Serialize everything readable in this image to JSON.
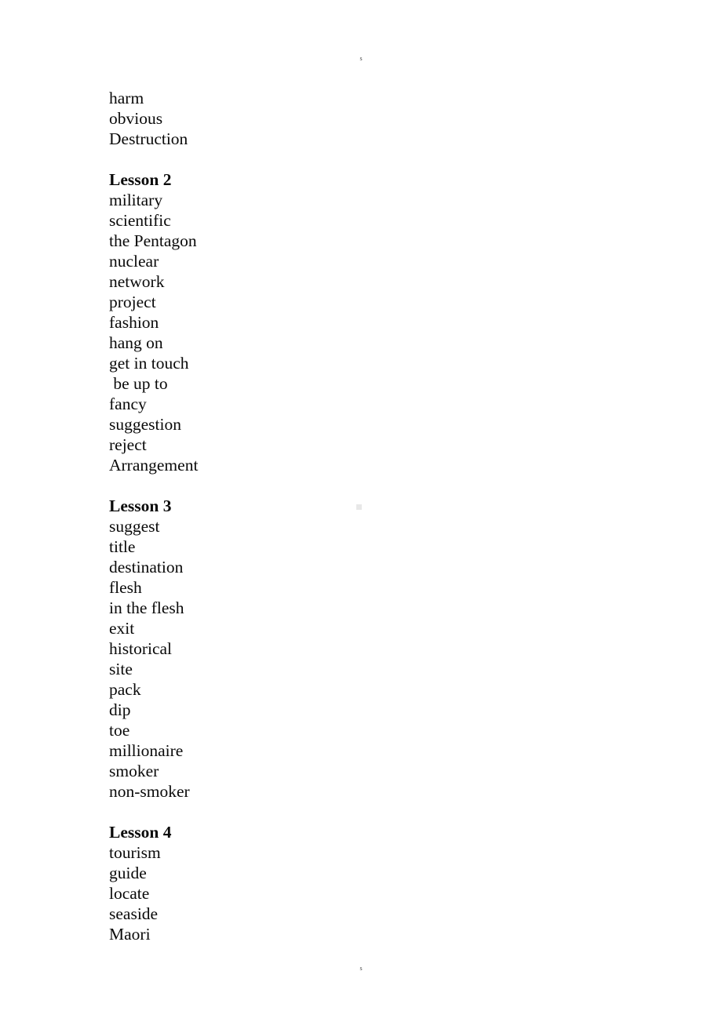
{
  "page": {
    "header_mark": "s",
    "footer_mark": "s",
    "background_color": "#ffffff",
    "text_color": "#0a0a0a"
  },
  "document": {
    "blocks": [
      {
        "kind": "word",
        "text": "harm"
      },
      {
        "kind": "word",
        "text": "obvious"
      },
      {
        "kind": "word",
        "text": "Destruction"
      },
      {
        "kind": "spacer",
        "text": ""
      },
      {
        "kind": "heading",
        "text": "Lesson 2"
      },
      {
        "kind": "word",
        "text": "military"
      },
      {
        "kind": "word",
        "text": "scientific"
      },
      {
        "kind": "word",
        "text": "the Pentagon"
      },
      {
        "kind": "word",
        "text": "nuclear"
      },
      {
        "kind": "word",
        "text": "network"
      },
      {
        "kind": "word",
        "text": "project"
      },
      {
        "kind": "word",
        "text": "fashion"
      },
      {
        "kind": "word",
        "text": "hang on"
      },
      {
        "kind": "word",
        "text": "get in touch"
      },
      {
        "kind": "word",
        "text": " be up to"
      },
      {
        "kind": "word",
        "text": "fancy"
      },
      {
        "kind": "word",
        "text": "suggestion"
      },
      {
        "kind": "word",
        "text": "reject"
      },
      {
        "kind": "word",
        "text": "Arrangement"
      },
      {
        "kind": "spacer",
        "text": ""
      },
      {
        "kind": "heading",
        "text": "Lesson 3"
      },
      {
        "kind": "word",
        "text": "suggest"
      },
      {
        "kind": "word",
        "text": "title"
      },
      {
        "kind": "word",
        "text": "destination"
      },
      {
        "kind": "word",
        "text": "flesh"
      },
      {
        "kind": "word",
        "text": "in the flesh"
      },
      {
        "kind": "word",
        "text": "exit"
      },
      {
        "kind": "word",
        "text": "historical"
      },
      {
        "kind": "word",
        "text": "site"
      },
      {
        "kind": "word",
        "text": "pack"
      },
      {
        "kind": "word",
        "text": "dip"
      },
      {
        "kind": "word",
        "text": "toe"
      },
      {
        "kind": "word",
        "text": "millionaire"
      },
      {
        "kind": "word",
        "text": "smoker"
      },
      {
        "kind": "word",
        "text": "non-smoker"
      },
      {
        "kind": "spacer",
        "text": ""
      },
      {
        "kind": "heading",
        "text": "Lesson 4"
      },
      {
        "kind": "word",
        "text": "tourism"
      },
      {
        "kind": "word",
        "text": "guide"
      },
      {
        "kind": "word",
        "text": "locate"
      },
      {
        "kind": "word",
        "text": "seaside"
      },
      {
        "kind": "word",
        "text": "Maori"
      }
    ]
  }
}
